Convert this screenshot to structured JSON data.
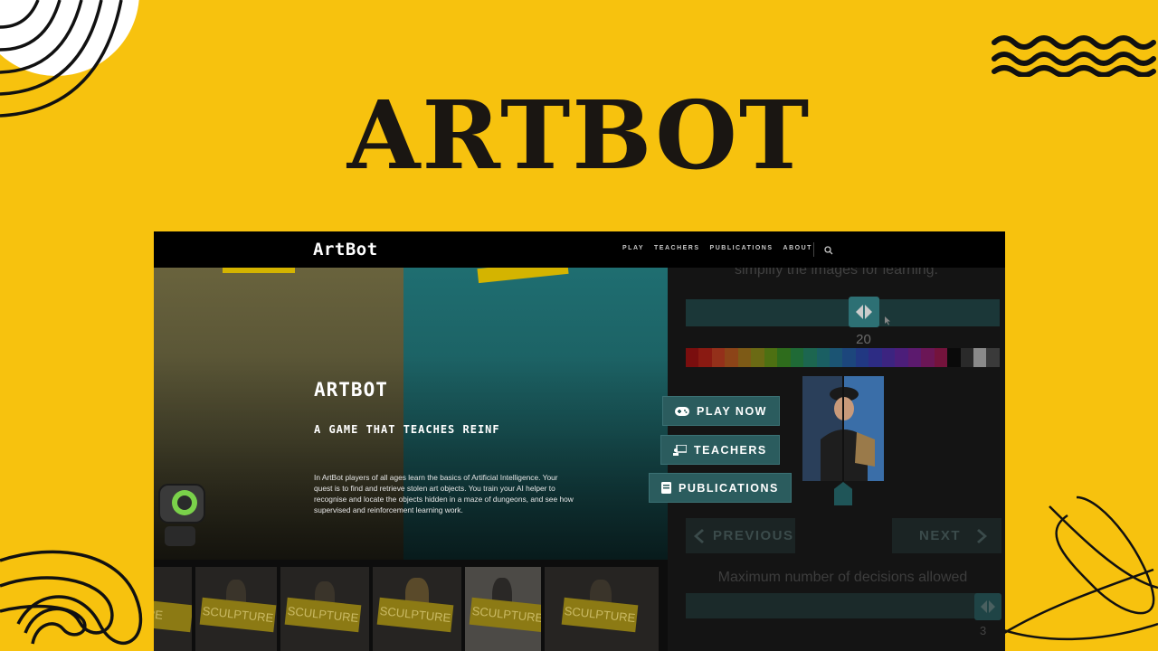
{
  "banner": {
    "title": "ARTBOT"
  },
  "site": {
    "logo": "ArtBot",
    "nav": [
      "PLAY",
      "TEACHERS",
      "PUBLICATIONS",
      "ABOUT"
    ]
  },
  "hero": {
    "title": "ARTBOT",
    "subtitle": "A GAME THAT TEACHES REINF",
    "description": "In ArtBot players of all ages learn the basics of Artificial Intelligence. Your quest is to find and retrieve stolen art objects. You train your AI helper to recognise and locate the objects hidden in a maze of dungeons, and see how supervised and reinforcement learning work."
  },
  "cta": {
    "play": "PLAY NOW",
    "teachers": "TEACHERS",
    "publications": "PUBLICATIONS"
  },
  "thumbnails": [
    {
      "label": "RE"
    },
    {
      "label": "SCULPTURE"
    },
    {
      "label": "SCULPTURE"
    },
    {
      "label": "SCULPTURE"
    },
    {
      "label": "SCULPTURE"
    },
    {
      "label": "SCULPTURE"
    }
  ],
  "panel": {
    "top_text": "simplify the images for learning.",
    "slider_value": "20",
    "previous": "PREVIOUS",
    "next": "NEXT",
    "bottom_text": "Maximum number of decisions allowed",
    "slider2_value": "3",
    "palette": [
      "#7a0e0e",
      "#8a1a12",
      "#94301a",
      "#8c4418",
      "#7d5a16",
      "#6b6a14",
      "#4d7012",
      "#2e6c1c",
      "#1f6a36",
      "#1c6650",
      "#1a5f63",
      "#1b5473",
      "#1c467c",
      "#213882",
      "#2d2c84",
      "#3c2480",
      "#4c1e7a",
      "#5c1a6e",
      "#6b1656",
      "#74133c",
      "#0a0a0a",
      "#2a2a2a",
      "#8a8a8a",
      "#3a3a3a"
    ]
  },
  "icons": {
    "search": "search-icon",
    "gamepad": "gamepad-icon",
    "teacher": "teacher-icon",
    "book": "book-icon",
    "chevron_left": "chevron-left-icon",
    "chevron_right": "chevron-right-icon"
  }
}
